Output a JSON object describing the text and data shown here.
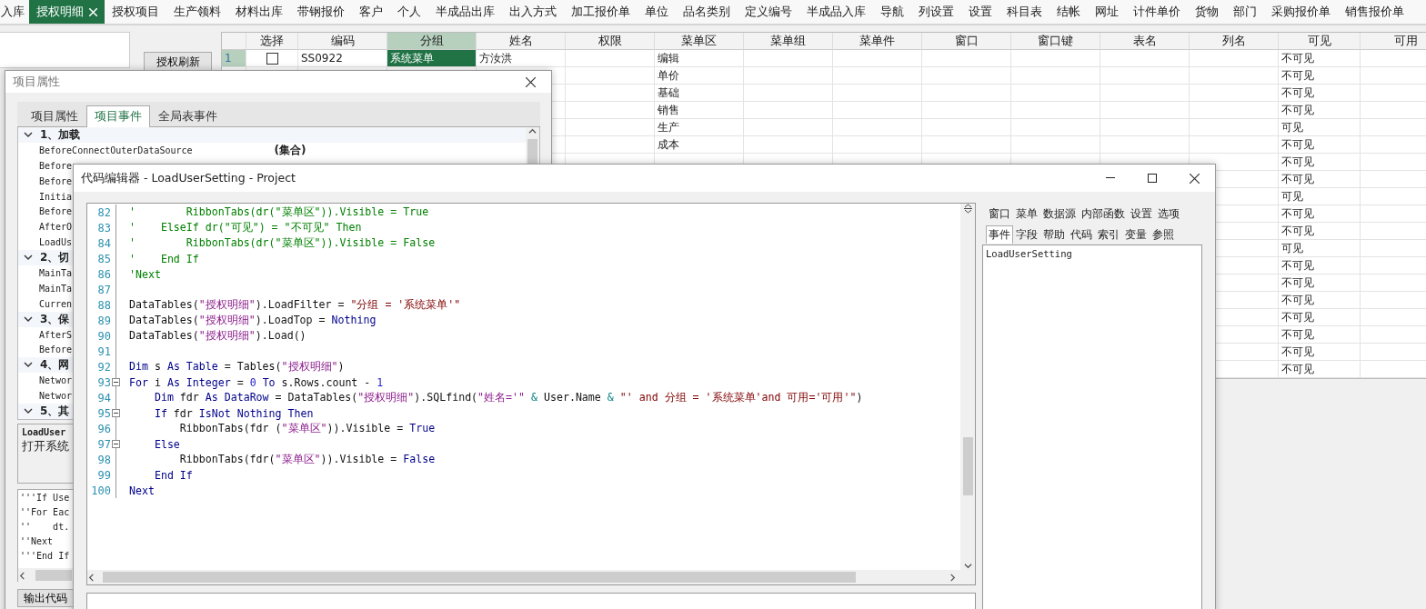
{
  "tabs": [
    {
      "label": "入库",
      "selected": false
    },
    {
      "label": "授权明细",
      "selected": true,
      "closable": true
    },
    {
      "label": "授权项目",
      "selected": false
    },
    {
      "label": "生产领料",
      "selected": false
    },
    {
      "label": "材料出库",
      "selected": false
    },
    {
      "label": "带钢报价",
      "selected": false
    },
    {
      "label": "客户",
      "selected": false
    },
    {
      "label": "个人",
      "selected": false
    },
    {
      "label": "半成品出库",
      "selected": false
    },
    {
      "label": "出入方式",
      "selected": false
    },
    {
      "label": "加工报价单",
      "selected": false
    },
    {
      "label": "单位",
      "selected": false
    },
    {
      "label": "品名类别",
      "selected": false
    },
    {
      "label": "定义编号",
      "selected": false
    },
    {
      "label": "半成品入库",
      "selected": false
    },
    {
      "label": "导航",
      "selected": false
    },
    {
      "label": "列设置",
      "selected": false
    },
    {
      "label": "设置",
      "selected": false
    },
    {
      "label": "科目表",
      "selected": false
    },
    {
      "label": "结帐",
      "selected": false
    },
    {
      "label": "网址",
      "selected": false
    },
    {
      "label": "计件单价",
      "selected": false
    },
    {
      "label": "货物",
      "selected": false
    },
    {
      "label": "部门",
      "selected": false
    },
    {
      "label": "采购报价单",
      "selected": false
    },
    {
      "label": "销售报价单",
      "selected": false
    }
  ],
  "refresh_button": "授权刷新",
  "table": {
    "columns": [
      {
        "label": "选择",
        "selected": false
      },
      {
        "label": "编码",
        "selected": false
      },
      {
        "label": "分组",
        "selected": true
      },
      {
        "label": "姓名",
        "selected": false
      },
      {
        "label": "权限",
        "selected": false
      },
      {
        "label": "菜单区",
        "selected": false
      },
      {
        "label": "菜单组",
        "selected": false
      },
      {
        "label": "菜单件",
        "selected": false
      },
      {
        "label": "窗口",
        "selected": false
      },
      {
        "label": "窗口键",
        "selected": false
      },
      {
        "label": "表名",
        "selected": false
      },
      {
        "label": "列名",
        "selected": false
      },
      {
        "label": "可见",
        "selected": false
      },
      {
        "label": "可用",
        "selected": false
      }
    ],
    "rows": [
      {
        "number": "1",
        "selected": true,
        "checked": false,
        "code": "SS0922",
        "group": "系统菜单",
        "name": "方汝洪",
        "menu_area": "编辑",
        "visible": "不可见"
      },
      {
        "menu_area": "单价",
        "visible": "不可见"
      },
      {
        "menu_area": "基础",
        "visible": "不可见"
      },
      {
        "menu_area": "销售",
        "visible": "不可见"
      },
      {
        "menu_area": "生产",
        "visible": "可见"
      },
      {
        "menu_area": "成本",
        "visible": "不可见"
      },
      {
        "visible": "不可见"
      },
      {
        "visible": "不可见"
      },
      {
        "visible": "可见"
      },
      {
        "visible": "不可见"
      },
      {
        "visible": "不可见"
      },
      {
        "visible": "可见"
      },
      {
        "visible": "不可见"
      },
      {
        "visible": "不可见"
      },
      {
        "visible": "不可见"
      },
      {
        "visible": "不可见"
      },
      {
        "visible": "不可见"
      },
      {
        "visible": "不可见"
      },
      {
        "visible": "不可见"
      }
    ]
  },
  "properties_window": {
    "title": "项目属性",
    "tabs": [
      {
        "label": "项目属性",
        "selected": false
      },
      {
        "label": "项目事件",
        "selected": true
      },
      {
        "label": "全局表事件",
        "selected": false
      }
    ],
    "categories": [
      {
        "label": "1、加载",
        "expanded": true,
        "items": [
          {
            "name": "BeforeConnectOuterDataSource",
            "value": "(集合)"
          },
          {
            "name": "Before"
          },
          {
            "name": "Before"
          },
          {
            "name": "Initia"
          },
          {
            "name": "Before"
          },
          {
            "name": "AfterO"
          },
          {
            "name": "LoadUs"
          }
        ]
      },
      {
        "label": "2、切",
        "expanded": true,
        "items": [
          {
            "name": "MainTa"
          },
          {
            "name": "MainTa"
          },
          {
            "name": "Curren"
          }
        ]
      },
      {
        "label": "3、保",
        "expanded": true,
        "items": [
          {
            "name": "AfterS"
          },
          {
            "name": "Before"
          }
        ]
      },
      {
        "label": "4、网",
        "expanded": true,
        "items": [
          {
            "name": "Networ"
          },
          {
            "name": "Networ"
          }
        ]
      },
      {
        "label": "5、其",
        "expanded": true
      }
    ],
    "description": {
      "title": "LoadUser",
      "text": "打开系统"
    },
    "code_preview": [
      "'''If Use",
      "''For Eac",
      "''    dt.",
      "''Next",
      "'''End If"
    ],
    "export_button": "输出代码"
  },
  "editor_window": {
    "title": "代码编辑器 - LoadUserSetting - Project",
    "lines": [
      {
        "number": "82",
        "segments": [
          {
            "kind": "comment",
            "text": "'        RibbonTabs(dr(\"菜单区\")).Visible = True"
          }
        ]
      },
      {
        "number": "83",
        "segments": [
          {
            "kind": "comment",
            "text": "'    ElseIf dr(\"可见\") = \"不可见\" Then"
          }
        ]
      },
      {
        "number": "84",
        "segments": [
          {
            "kind": "comment",
            "text": "'        RibbonTabs(dr(\"菜单区\")).Visible = False"
          }
        ]
      },
      {
        "number": "85",
        "segments": [
          {
            "kind": "comment",
            "text": "'    End If"
          }
        ]
      },
      {
        "number": "86",
        "segments": [
          {
            "kind": "comment",
            "text": "'Next"
          }
        ]
      },
      {
        "number": "87"
      },
      {
        "number": "88",
        "segments": [
          {
            "kind": "plain",
            "text": "DataTables("
          },
          {
            "kind": "string",
            "text": "\"授权明细\""
          },
          {
            "kind": "plain",
            "text": ").LoadFilter = "
          },
          {
            "kind": "sql",
            "text": "\"分组 = '系统菜单'\""
          }
        ]
      },
      {
        "number": "89",
        "segments": [
          {
            "kind": "plain",
            "text": "DataTables("
          },
          {
            "kind": "string",
            "text": "\"授权明细\""
          },
          {
            "kind": "plain",
            "text": ").LoadTop = "
          },
          {
            "kind": "keyword",
            "text": "Nothing"
          }
        ]
      },
      {
        "number": "90",
        "segments": [
          {
            "kind": "plain",
            "text": "DataTables("
          },
          {
            "kind": "string",
            "text": "\"授权明细\""
          },
          {
            "kind": "plain",
            "text": ").Load()"
          }
        ]
      },
      {
        "number": "91"
      },
      {
        "number": "92",
        "segments": [
          {
            "kind": "keyword",
            "text": "Dim"
          },
          {
            "kind": "plain",
            "text": " s "
          },
          {
            "kind": "keyword",
            "text": "As Table"
          },
          {
            "kind": "plain",
            "text": " = Tables("
          },
          {
            "kind": "string",
            "text": "\"授权明细\""
          },
          {
            "kind": "plain",
            "text": ")"
          }
        ]
      },
      {
        "number": "93",
        "fold": true,
        "segments": [
          {
            "kind": "keyword",
            "text": "For"
          },
          {
            "kind": "plain",
            "text": " i "
          },
          {
            "kind": "keyword",
            "text": "As Integer"
          },
          {
            "kind": "plain",
            "text": " = "
          },
          {
            "kind": "number",
            "text": "0"
          },
          {
            "kind": "keyword",
            "text": " To"
          },
          {
            "kind": "plain",
            "text": " s.Rows.count - "
          },
          {
            "kind": "number",
            "text": "1"
          }
        ]
      },
      {
        "number": "94",
        "segments": [
          {
            "kind": "keyword",
            "text": "    Dim"
          },
          {
            "kind": "plain",
            "text": " fdr "
          },
          {
            "kind": "keyword",
            "text": "As DataRow"
          },
          {
            "kind": "plain",
            "text": " = DataTables("
          },
          {
            "kind": "string",
            "text": "\"授权明细\""
          },
          {
            "kind": "plain",
            "text": ").SQLfind("
          },
          {
            "kind": "string",
            "text": "\"姓名='\""
          },
          {
            "kind": "operator",
            "text": " & "
          },
          {
            "kind": "plain",
            "text": "User.Name"
          },
          {
            "kind": "operator",
            "text": " & "
          },
          {
            "kind": "sql",
            "text": "\"' and 分组 = '系统菜单'and 可用='可用'\""
          },
          {
            "kind": "plain",
            "text": ")"
          }
        ]
      },
      {
        "number": "95",
        "fold": true,
        "segments": [
          {
            "kind": "keyword",
            "text": "    If"
          },
          {
            "kind": "plain",
            "text": " fdr "
          },
          {
            "kind": "keyword",
            "text": "IsNot Nothing Then"
          }
        ]
      },
      {
        "number": "96",
        "segments": [
          {
            "kind": "plain",
            "text": "        RibbonTabs(fdr ("
          },
          {
            "kind": "string",
            "text": "\"菜单区\""
          },
          {
            "kind": "plain",
            "text": ")).Visible = "
          },
          {
            "kind": "keyword",
            "text": "True"
          }
        ]
      },
      {
        "number": "97",
        "fold": true,
        "segments": [
          {
            "kind": "keyword",
            "text": "    Else"
          }
        ]
      },
      {
        "number": "98",
        "segments": [
          {
            "kind": "plain",
            "text": "        RibbonTabs(fdr("
          },
          {
            "kind": "string",
            "text": "\"菜单区\""
          },
          {
            "kind": "plain",
            "text": ")).Visible = "
          },
          {
            "kind": "keyword",
            "text": "False"
          }
        ]
      },
      {
        "number": "99",
        "segments": [
          {
            "kind": "keyword",
            "text": "    End If"
          }
        ]
      },
      {
        "number": "100",
        "segments": [
          {
            "kind": "keyword",
            "text": "Next"
          }
        ]
      }
    ],
    "panel_tabs": [
      [
        {
          "label": "窗口",
          "selected": false
        },
        {
          "label": "菜单",
          "selected": false
        },
        {
          "label": "数据源",
          "selected": false
        },
        {
          "label": "内部函数",
          "selected": false
        },
        {
          "label": "设置",
          "selected": false
        },
        {
          "label": "选项",
          "selected": false
        }
      ],
      [
        {
          "label": "事件",
          "selected": true
        },
        {
          "label": "字段",
          "selected": false
        },
        {
          "label": "帮助",
          "selected": false
        },
        {
          "label": "代码",
          "selected": false
        },
        {
          "label": "索引",
          "selected": false
        },
        {
          "label": "变量",
          "selected": false
        },
        {
          "label": "参照",
          "selected": false
        }
      ]
    ],
    "panel_items": [
      "LoadUserSetting"
    ]
  }
}
